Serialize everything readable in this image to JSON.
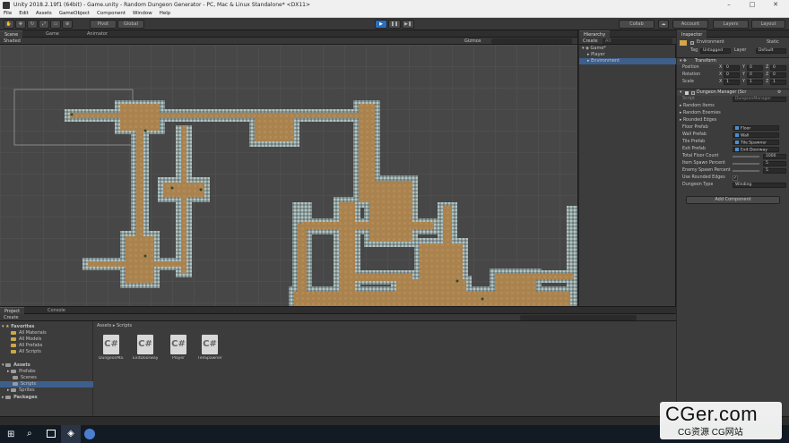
{
  "window": {
    "title": "Unity 2018.2.19f1 (64bit) - Game.unity - Random Dungeon Generator - PC, Mac & Linux Standalone* <DX11>"
  },
  "menu": [
    "File",
    "Edit",
    "Assets",
    "GameObject",
    "Component",
    "Window",
    "Help"
  ],
  "toolbar": {
    "pivot": "Pivot",
    "global": "Global",
    "collab": "Collab",
    "account": "Account",
    "layers": "Layers",
    "layout": "Layout"
  },
  "scene": {
    "tabs": [
      "Scene",
      "Game",
      "Animator"
    ],
    "shading": "Shaded",
    "gizmos": "Gizmos"
  },
  "hierarchy": {
    "tab": "Hierarchy",
    "create": "Create",
    "search_placeholder": "All",
    "scene_name": "Game*",
    "items": [
      "Player",
      "Environment"
    ]
  },
  "inspector": {
    "tab": "Inspector",
    "object_name": "Environment",
    "static_label": "Static",
    "tag_label": "Tag",
    "tag_value": "Untagged",
    "layer_label": "Layer",
    "layer_value": "Default",
    "transform": {
      "header": "Transform",
      "rows": [
        {
          "label": "Position",
          "x": "0",
          "y": "0",
          "z": "0"
        },
        {
          "label": "Rotation",
          "x": "0",
          "y": "0",
          "z": "0"
        },
        {
          "label": "Scale",
          "x": "1",
          "y": "1",
          "z": "1"
        }
      ]
    },
    "script": {
      "header": "Dungeon Manager (Scr",
      "script_label": "Script",
      "script_value": "DungeonManager",
      "foldouts": [
        "Random Items",
        "Random Enemies",
        "Rounded Edges"
      ],
      "fields": [
        {
          "label": "Floor Prefab",
          "value": "Floor"
        },
        {
          "label": "Wall Prefab",
          "value": "Wall"
        },
        {
          "label": "Tile Prefab",
          "value": "Tile Spawner"
        },
        {
          "label": "Exit Prefab",
          "value": "Exit Doorway"
        }
      ],
      "total_floor_label": "Total Floor Count",
      "total_floor_value": "1000",
      "item_spawn_label": "Item Spawn Percent",
      "item_spawn_value": "5",
      "enemy_spawn_label": "Enemy Spawn Percent",
      "enemy_spawn_value": "5",
      "use_rounded_label": "Use Rounded Edges",
      "dungeon_type_label": "Dungeon Type",
      "dungeon_type_value": "Winding"
    },
    "add_component": "Add Component"
  },
  "project": {
    "tabs": [
      "Project",
      "Console"
    ],
    "create": "Create",
    "favorites_header": "Favorites",
    "favorites": [
      "All Materials",
      "All Models",
      "All Prefabs",
      "All Scripts"
    ],
    "assets_header": "Assets",
    "asset_folders": [
      "Prefabs",
      "Scenes",
      "Scripts",
      "Sprites"
    ],
    "packages_header": "Packages",
    "breadcrumb_root": "Assets",
    "breadcrumb_sep": "▸",
    "breadcrumb_leaf": "Scripts",
    "files": [
      "DungeonMa...",
      "ExitDoorway",
      "Player",
      "TileSpawner"
    ]
  },
  "watermark": {
    "big": "CGer.com",
    "small": "CG资源 CG网站"
  },
  "colors": {
    "floor": "#a9824e",
    "wall": "#8fa0a0",
    "selection": "#3d5f8c",
    "accent": "#2a6fbf"
  }
}
